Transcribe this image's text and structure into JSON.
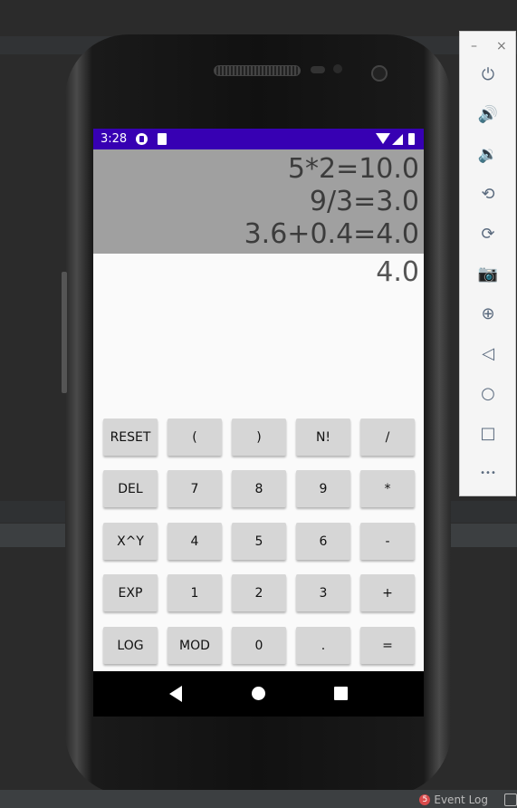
{
  "status_bar": {
    "time": "3:28"
  },
  "calculator": {
    "history": [
      "5*2=10.0",
      "9/3=3.0",
      "3.6+0.4=4.0"
    ],
    "result": "4.0",
    "keys": [
      [
        "RESET",
        "(",
        ")",
        "N!",
        "/"
      ],
      [
        "DEL",
        "7",
        "8",
        "9",
        "*"
      ],
      [
        "X^Y",
        "4",
        "5",
        "6",
        "-"
      ],
      [
        "EXP",
        "1",
        "2",
        "3",
        "+"
      ],
      [
        "LOG",
        "MOD",
        "0",
        ".",
        "="
      ]
    ]
  },
  "emulator_toolbar": {
    "minimize": "–",
    "close": "×",
    "buttons": [
      {
        "name": "power-icon",
        "glyph": "⏻"
      },
      {
        "name": "volume-up-icon",
        "glyph": "🔊"
      },
      {
        "name": "volume-down-icon",
        "glyph": "🔉"
      },
      {
        "name": "rotate-left-icon",
        "glyph": "⟲"
      },
      {
        "name": "rotate-right-icon",
        "glyph": "⟳"
      },
      {
        "name": "camera-icon",
        "glyph": "📷"
      },
      {
        "name": "zoom-icon",
        "glyph": "⊕"
      },
      {
        "name": "back-icon",
        "glyph": "◁"
      },
      {
        "name": "home-icon",
        "glyph": "○"
      },
      {
        "name": "overview-icon",
        "glyph": "□"
      },
      {
        "name": "more-icon",
        "glyph": "•••"
      }
    ]
  },
  "ide": {
    "event_log_label": "Event Log",
    "event_log_count": "5"
  },
  "colors": {
    "status_bar": "#3700b3",
    "history_bg": "#a0a0a0",
    "key_bg": "#d6d6d6"
  }
}
